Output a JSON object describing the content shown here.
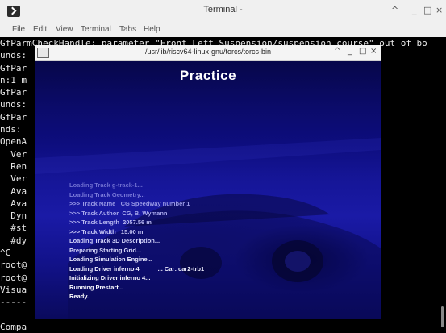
{
  "terminal": {
    "title": "Terminal -",
    "controls": {
      "minimize": "^",
      "restore": "_",
      "maximize": "□",
      "close": "×"
    },
    "menu": [
      "File",
      "Edit",
      "View",
      "Terminal",
      "Tabs",
      "Help"
    ],
    "lines": [
      "GfParmCheckHandle: parameter \"Front Left Suspension/suspension course\" out of bo",
      "unds:                                                      fault.xml\")",
      "GfPar                                                      bounds: mi",
      "n:1 m",
      "GfPar                                                      out of bo",
      "unds:                                                      fault.xml\")",
      "GfPar                                                     out of bou",
      "nds:                                                      ult.xml\")",
      "OpenA",
      "  Ver",
      "  Ren",
      "  Ver",
      "  Ava",
      "  Ava",
      "  Dyn",
      "  #st",
      "  #dy",
      "^C",
      "root@",
      "root@",
      "Visua",
      "-----",
      "",
      "Compa",
      "[]"
    ]
  },
  "game": {
    "title": "/usr/lib/riscv64-linux-gnu/torcs/torcs-bin",
    "controls": {
      "minimize": "^",
      "restore": "_",
      "maximize": "□",
      "close": "×"
    },
    "heading": "Practice",
    "loading": [
      {
        "text": "Loading Track g-track-1...",
        "color": "#6f6fd0"
      },
      {
        "text": "Loading Track Geometry...",
        "color": "#7a7ada"
      },
      {
        "text": ">>> Track Name   CG Speedway number 1",
        "color": "#9a9ae6"
      },
      {
        "text": ">>> Track Author  CG, B. Wymann",
        "color": "#a8a8ec"
      },
      {
        "text": ">>> Track Length  2057.56 m",
        "color": "#b6b6f0"
      },
      {
        "text": ">>> Track Width   15.00 m",
        "color": "#c4c4f4"
      },
      {
        "text": "Loading Track 3D Description...",
        "color": "#d0d0f8"
      },
      {
        "text": "Preparing Starting Grid...",
        "color": "#dadafa"
      },
      {
        "text": "Loading Simulation Engine...",
        "color": "#e4e4fc"
      },
      {
        "text": "Loading Driver inferno 4           ... Car: car2-trb1",
        "color": "#ececfd"
      },
      {
        "text": "Initializing Driver inferno 4...",
        "color": "#f4f4fe"
      },
      {
        "text": "Running Prestart...",
        "color": "#fafaff"
      },
      {
        "text": "Ready.",
        "color": "#ffffff"
      }
    ]
  },
  "colors": {
    "terminal_bg": "#000000",
    "game_bg": "#1a1aa6",
    "titlebar": "#f0f0f0"
  }
}
